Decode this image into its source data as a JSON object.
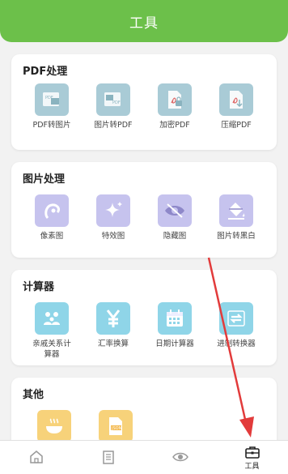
{
  "header": {
    "title": "工具"
  },
  "sections": [
    {
      "title": "PDF处理",
      "items": [
        {
          "label": "PDF转图片",
          "icon": "pdf-to-image-icon"
        },
        {
          "label": "图片转PDF",
          "icon": "image-to-pdf-icon"
        },
        {
          "label": "加密PDF",
          "icon": "encrypt-pdf-icon"
        },
        {
          "label": "压缩PDF",
          "icon": "compress-pdf-icon"
        }
      ]
    },
    {
      "title": "图片处理",
      "items": [
        {
          "label": "像素图",
          "icon": "pixel-face-icon"
        },
        {
          "label": "特效图",
          "icon": "sparkle-icon"
        },
        {
          "label": "隐藏图",
          "icon": "eye-slash-icon"
        },
        {
          "label": "图片转黑白",
          "icon": "paint-bucket-icon"
        }
      ]
    },
    {
      "title": "计算器",
      "items": [
        {
          "label": "亲戚关系计算器",
          "icon": "family-icon"
        },
        {
          "label": "汇率换算",
          "icon": "yen-icon"
        },
        {
          "label": "日期计算器",
          "icon": "calendar-icon"
        },
        {
          "label": "进制转换器",
          "icon": "convert-arrows-icon"
        }
      ]
    },
    {
      "title": "其他",
      "items": [
        {
          "label": "",
          "icon": "bowl-icon"
        },
        {
          "label": "",
          "icon": "json-icon"
        }
      ]
    }
  ],
  "tabbar": {
    "tabs": [
      {
        "label": "",
        "icon": "home-icon"
      },
      {
        "label": "",
        "icon": "document-icon"
      },
      {
        "label": "",
        "icon": "eye-icon"
      },
      {
        "label": "工具",
        "icon": "toolbox-icon"
      }
    ]
  },
  "colors": {
    "header": "#6cc04a",
    "pdf_tile": "#a9cbd6",
    "image_tile": "#c6c3ee",
    "calc_tile": "#8fd5e8",
    "other_tile": "#f7d27a",
    "annotation_arrow": "#e23b3b"
  }
}
